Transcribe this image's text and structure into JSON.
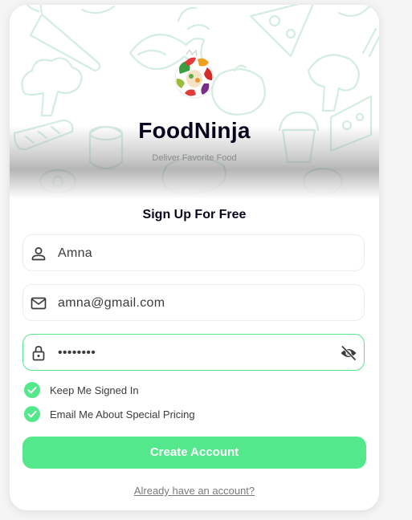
{
  "hero": {
    "logo_icon": "food-ninja-logo-icon",
    "pattern_icon": "food-doodle-pattern",
    "app_title": "FoodNinja",
    "tagline": "Deliver Favorite Food"
  },
  "form": {
    "heading": "Sign Up For Free",
    "name_field": {
      "icon": "person-icon",
      "value": "Amna"
    },
    "email_field": {
      "icon": "mail-icon",
      "value": "amna@gmail.com"
    },
    "password_field": {
      "icon": "lock-icon",
      "value": "••••••••",
      "toggle_icon": "eye-off-icon"
    },
    "options": [
      {
        "label": "Keep Me Signed In",
        "checked": true
      },
      {
        "label": "Email Me About Special Pricing",
        "checked": true
      }
    ],
    "submit_label": "Create Account",
    "login_link": "Already have an account?"
  },
  "colors": {
    "accent": "#53e88b",
    "title": "#09051c",
    "pattern": "#d7efe2"
  }
}
